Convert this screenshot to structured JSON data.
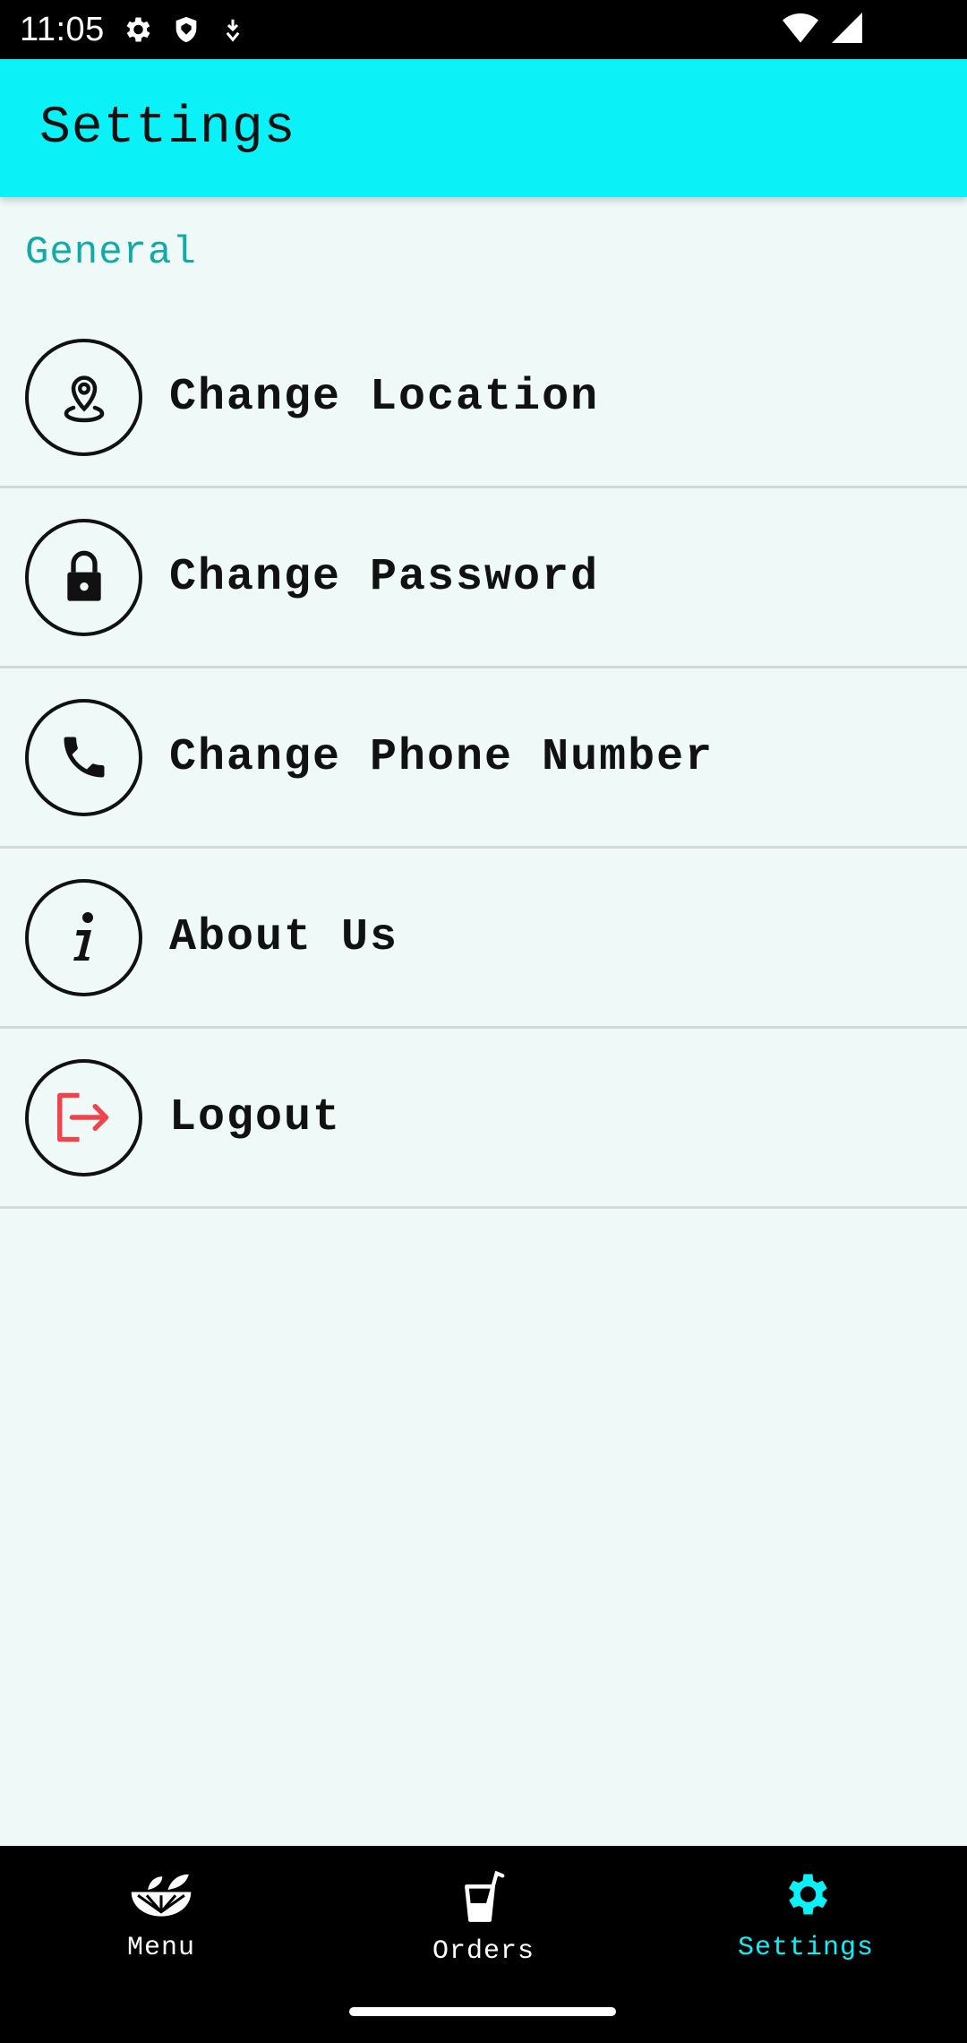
{
  "status_bar": {
    "time": "11:05",
    "icons": [
      "gear-icon",
      "shield-icon",
      "download-icon",
      "wifi-icon",
      "signal-icon"
    ]
  },
  "app_bar": {
    "title": "Settings"
  },
  "section": {
    "title": "General"
  },
  "settings_items": [
    {
      "label": "Change Location",
      "icon": "location-pin-icon"
    },
    {
      "label": "Change Password",
      "icon": "lock-icon"
    },
    {
      "label": "Change Phone Number",
      "icon": "phone-icon"
    },
    {
      "label": "About Us",
      "icon": "info-icon"
    },
    {
      "label": "Logout",
      "icon": "logout-icon"
    }
  ],
  "bottom_nav": {
    "items": [
      {
        "label": "Menu",
        "icon": "fruit-slice-icon"
      },
      {
        "label": "Orders",
        "icon": "drink-cup-icon"
      },
      {
        "label": "Settings",
        "icon": "gear-icon"
      }
    ],
    "active": "Settings"
  },
  "colors": {
    "accent": "#0af1f7",
    "section_title": "#11aaa8",
    "background": "#eef9f8",
    "logout_icon": "#f0444c"
  }
}
